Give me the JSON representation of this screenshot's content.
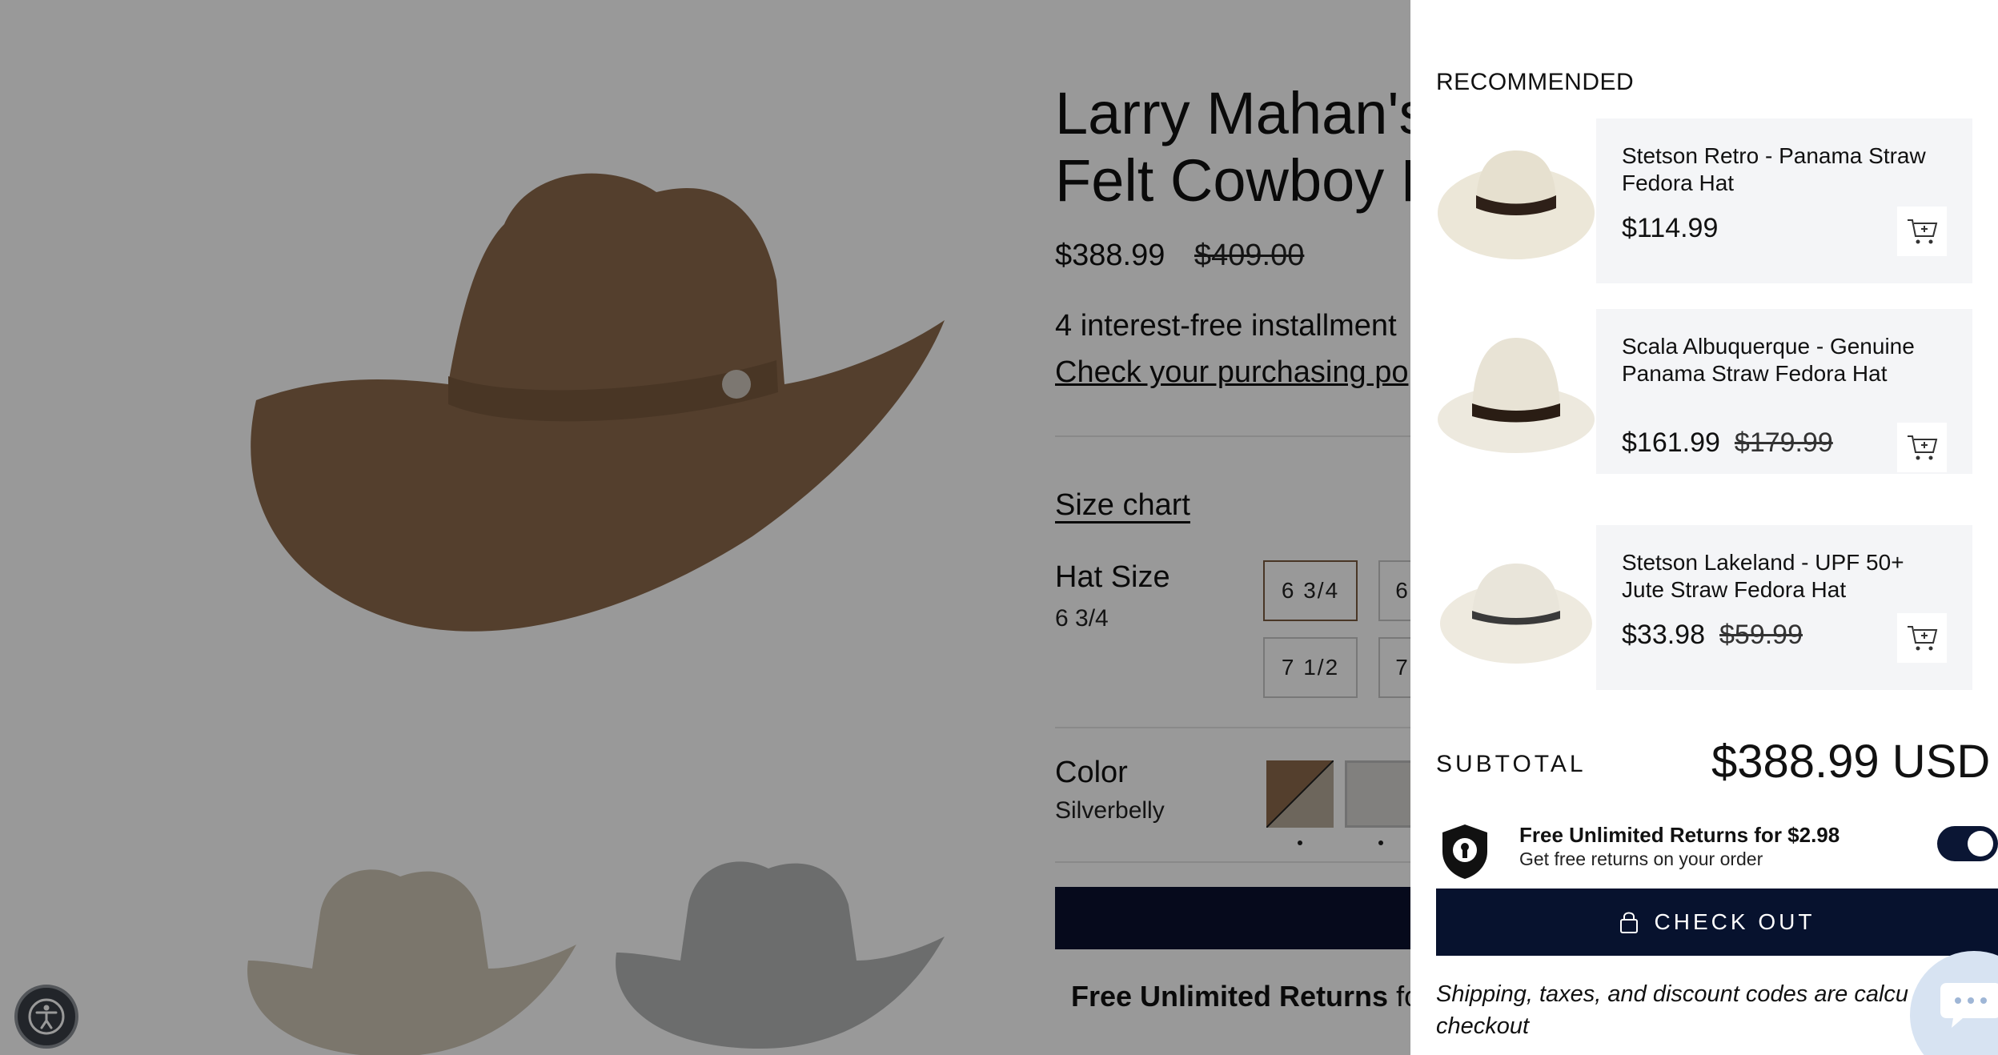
{
  "product": {
    "title": "Larry Mahan's\nFelt Cowboy H",
    "price": "$388.99",
    "compare_price": "$409.00",
    "installments": "4 interest-free installment",
    "check_link": "Check your purchasing po",
    "size_chart": "Size chart",
    "hat_size_label": "Hat Size",
    "hat_size_value": "6 3/4",
    "sizes": [
      "6 3/4",
      "6",
      "7 1/2",
      "7"
    ],
    "color_label": "Color",
    "color_value": "Silverbelly",
    "returns_bold": "Free Unlimited Returns",
    "returns_rest": " fo"
  },
  "cart": {
    "recommended_heading": "RECOMMENDED",
    "recommended": [
      {
        "name": "Stetson Retro - Panama Straw Fedora Hat",
        "price": "$114.99",
        "compare": ""
      },
      {
        "name": "Scala Albuquerque - Genuine Panama Straw Fedora Hat",
        "price": "$161.99",
        "compare": "$179.99"
      },
      {
        "name": "Stetson Lakeland - UPF 50+ Jute Straw Fedora Hat",
        "price": "$33.98",
        "compare": "$59.99"
      }
    ],
    "subtotal_label": "SUBTOTAL",
    "subtotal_value": "$388.99 USD",
    "returns_title": "Free Unlimited Returns for $2.98",
    "returns_sub": "Get free returns on your order",
    "returns_enabled": true,
    "checkout_label": "CHECK OUT",
    "shipping_note": "Shipping, taxes, and discount codes are calcu\ncheckout"
  },
  "icons": {
    "cart": "add-to-cart-icon",
    "lock": "lock-icon",
    "shield": "shield-icon",
    "chat": "chat-icon",
    "accessibility": "accessibility-icon"
  },
  "colors": {
    "navy": "#07122e",
    "hat_brown": "#8c6a4c",
    "card_bg": "#f4f5f7"
  }
}
